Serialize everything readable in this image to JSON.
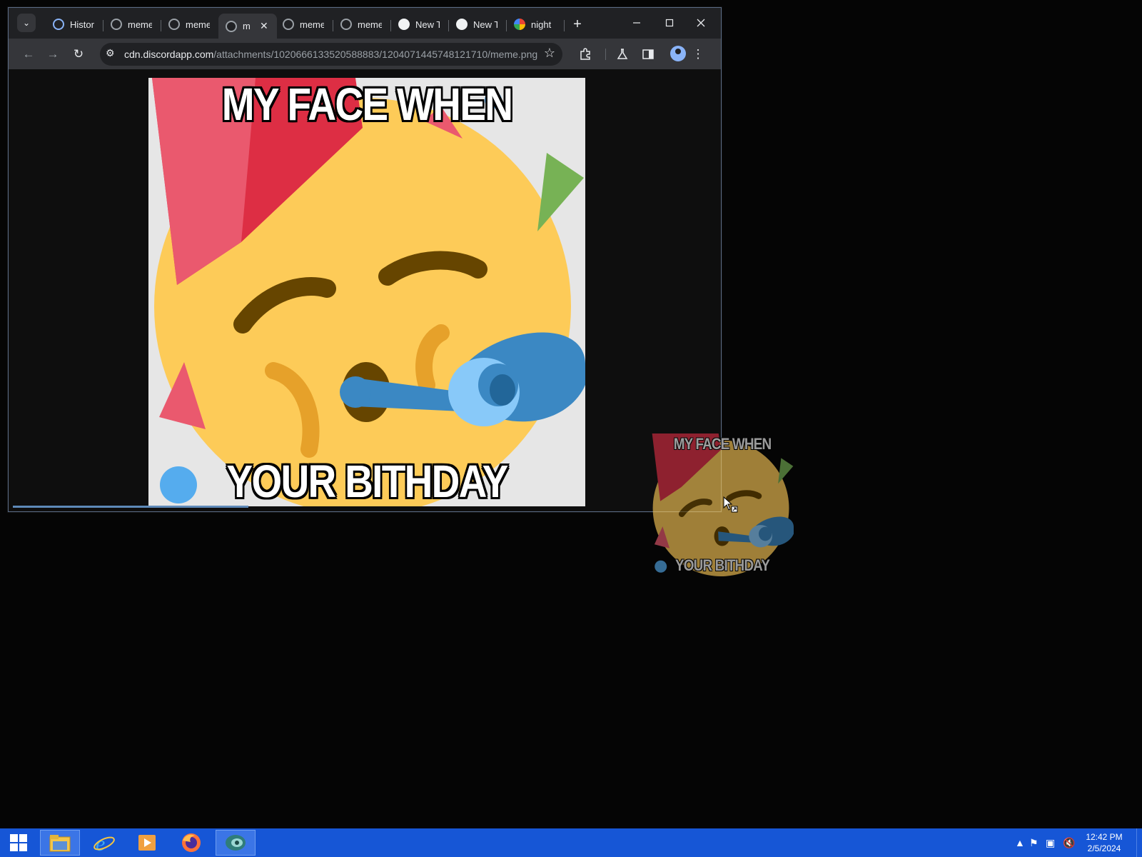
{
  "browser": {
    "tabs": [
      {
        "label": "Histor",
        "icon": "history-icon"
      },
      {
        "label": "meme",
        "icon": "globe-icon"
      },
      {
        "label": "meme",
        "icon": "globe-icon"
      },
      {
        "label": "m",
        "icon": "globe-icon",
        "active": true
      },
      {
        "label": "meme",
        "icon": "globe-icon"
      },
      {
        "label": "meme",
        "icon": "globe-icon"
      },
      {
        "label": "New T",
        "icon": "chat-icon"
      },
      {
        "label": "New T",
        "icon": "chat-icon"
      },
      {
        "label": "night",
        "icon": "google-icon"
      }
    ],
    "url_domain": "cdn.discordapp.com",
    "url_path": "/attachments/1020666133520588883/1204071445748121710/meme.png"
  },
  "meme": {
    "top_text": "MY FACE WHEN",
    "bottom_text": "YOUR BITHDAY"
  },
  "drag_ghost": {
    "top_text": "MY FACE WHEN",
    "bottom_text": "YOUR BITHDAY"
  },
  "taskbar": {
    "time": "12:42 PM",
    "date": "2/5/2024",
    "accent": "#1656d6"
  }
}
